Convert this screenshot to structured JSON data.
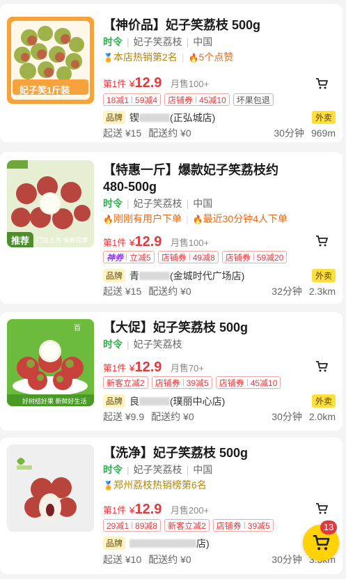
{
  "colors": {
    "price_red": "#e4393c",
    "season_green": "#2bb24c",
    "cart_yellow": "#ffd200",
    "takeout_yellow": "#ffe03a"
  },
  "products": [
    {
      "title": "【神价品】妃子笑荔枝 500g",
      "title_lines": [
        "【神价品】妃子笑荔枝 500g"
      ],
      "season": "时令",
      "variety": "妃子笑荔枝",
      "origin": "中国",
      "tags": [
        {
          "icon": "medal-icon",
          "text": "本店热销第2名"
        },
        {
          "icon": "flame-icon",
          "text": "5个点赞"
        }
      ],
      "first_label": "第1件",
      "currency": "¥",
      "price": "12.9",
      "sold": "月售100+",
      "coupons": [
        {
          "parts": [
            "18减1",
            "59减4"
          ]
        },
        {
          "parts": [
            "店铺券",
            "45减10"
          ]
        },
        {
          "parts": [
            "坏果包退"
          ],
          "style": "grey"
        }
      ],
      "brand_label": "品牌",
      "shop_visible": "(正弘城店)",
      "shop_prefix": "锲",
      "takeout": "外卖",
      "min_order": "起送 ¥15",
      "delivery_fee": "配送约 ¥0",
      "eta": "30分钟",
      "distance": "969m",
      "thumb_text": "妃子笑1斤装"
    },
    {
      "title": "【特惠一斤】爆款妃子笑荔枝约 480-500g",
      "title_lines": [
        "【特惠一斤】爆款妃子笑荔枝约",
        "480-500g"
      ],
      "season": "时令",
      "variety": "妃子笑荔枝",
      "origin": "中国",
      "tags": [
        {
          "icon": "flame-icon",
          "text": "刚刚有用户下单"
        },
        {
          "icon": "flame-icon",
          "text": "最近30分钟4人下单"
        }
      ],
      "first_label": "第1件",
      "currency": "¥",
      "price": "12.9",
      "sold": "月售100+",
      "coupons": [
        {
          "vip": "神券",
          "parts": [
            "立减5"
          ]
        },
        {
          "parts": [
            "店铺券",
            "49减8"
          ]
        },
        {
          "parts": [
            "店铺券",
            "59减20"
          ]
        }
      ],
      "brand_label": "品牌",
      "shop_visible": "(金城时代广场店)",
      "shop_prefix": "青",
      "takeout": "外卖",
      "min_order": "起送 ¥15",
      "delivery_fee": "配送约 ¥0",
      "eta": "32分钟",
      "distance": "2.3km",
      "thumb_badge": "推荐",
      "thumb_bottom": "门店上方 领券同享"
    },
    {
      "title": "【大促】妃子笑荔枝 500g",
      "title_lines": [
        "【大促】妃子笑荔枝 500g"
      ],
      "season": "时令",
      "variety": "妃子笑荔枝",
      "origin": "",
      "tags": [],
      "first_label": "第1件",
      "currency": "¥",
      "price": "12.9",
      "sold": "月售70+",
      "coupons": [
        {
          "parts": [
            "新客立减2"
          ]
        },
        {
          "parts": [
            "店铺券",
            "39减5"
          ]
        },
        {
          "parts": [
            "店铺券",
            "45减10"
          ]
        }
      ],
      "brand_label": "品牌",
      "shop_visible": "(璞丽中心店)",
      "shop_prefix": "良",
      "takeout": "外卖",
      "min_order": "起送 ¥9.9",
      "delivery_fee": "配送约 ¥0",
      "eta": "30分钟",
      "distance": "2.0km",
      "thumb_top": "百",
      "thumb_bottom": "好树结好果 新鲜好生活"
    },
    {
      "title": "【洗净】妃子笑荔枝 500g",
      "title_lines": [
        "【洗净】妃子笑荔枝 500g"
      ],
      "season": "时令",
      "variety": "妃子笑荔枝",
      "origin": "中国",
      "tags": [
        {
          "icon": "medal-icon",
          "text": "郑州荔枝热销榜第6名"
        }
      ],
      "first_label": "第1件",
      "currency": "¥",
      "price": "12.9",
      "sold": "月售200+",
      "coupons": [
        {
          "parts": [
            "29减1",
            "89减8"
          ]
        },
        {
          "parts": [
            "新客立减2"
          ]
        },
        {
          "parts": [
            "店铺券",
            "39减5"
          ]
        }
      ],
      "brand_label": "品牌",
      "shop_visible": "店)",
      "shop_prefix": "",
      "takeout": "",
      "min_order": "起送 ¥10",
      "delivery_fee": "配送约 ¥0",
      "eta": "30分钟",
      "distance": "3.5km"
    }
  ],
  "floating_cart": {
    "count": "13"
  }
}
